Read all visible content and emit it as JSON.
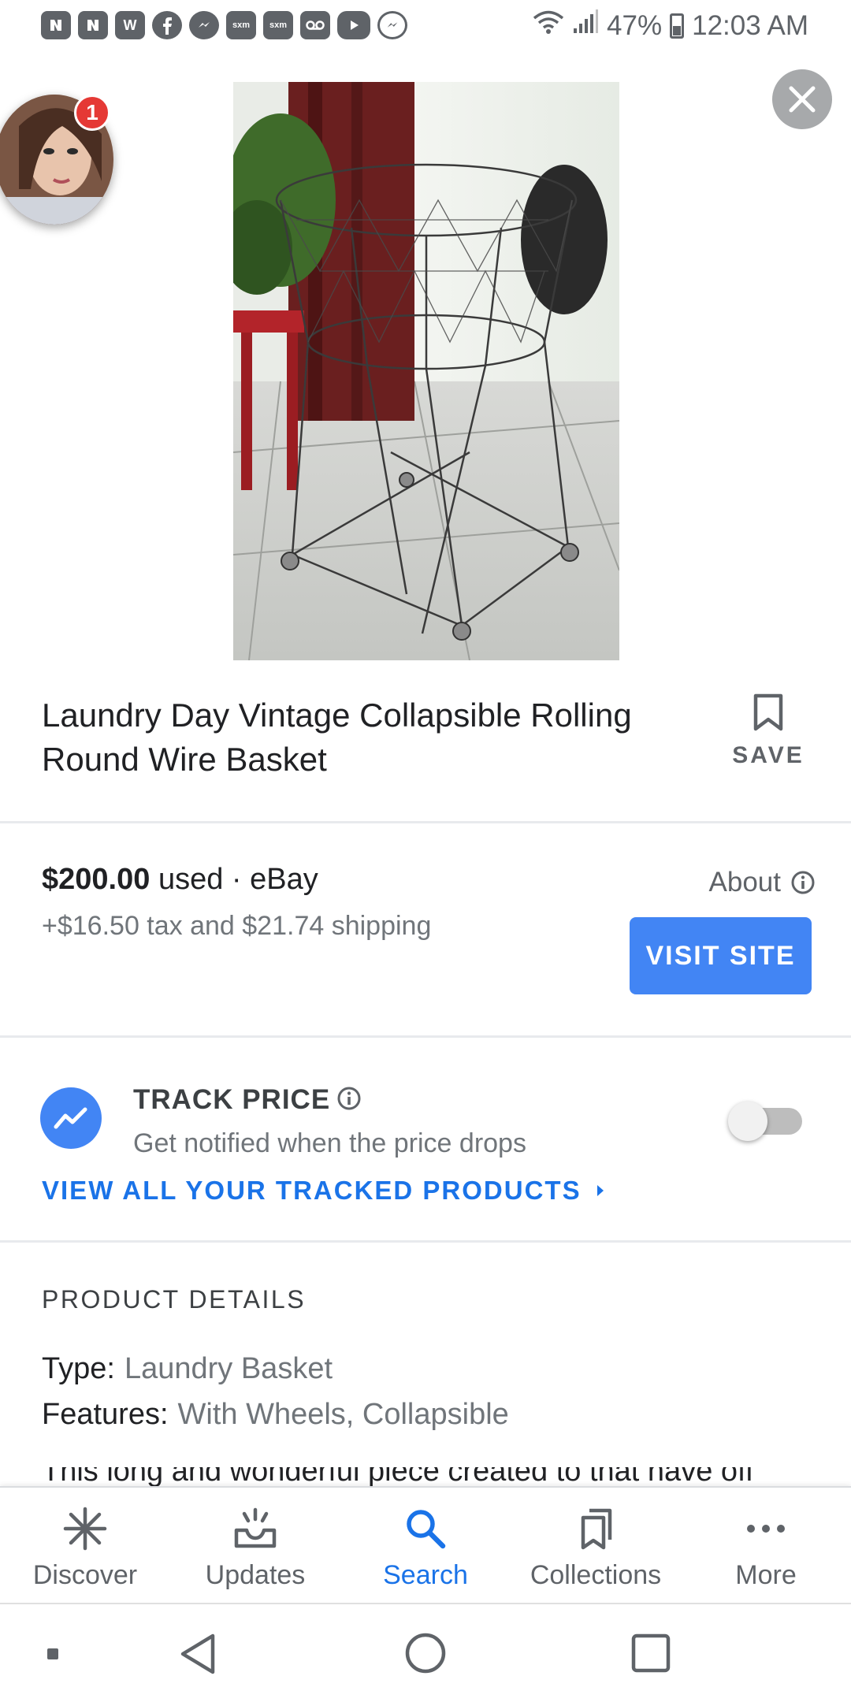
{
  "status_bar": {
    "notification_icons": [
      "nfl-icon",
      "nfl-icon",
      "walmart-icon",
      "facebook-icon",
      "messenger-icon",
      "sxm-icon",
      "sxm-icon",
      "voicemail-icon",
      "youtube-icon",
      "messenger-icon"
    ],
    "sxm_label": "sxm",
    "walmart_label": "W",
    "battery": "47%",
    "time": "12:03 AM"
  },
  "chat_head": {
    "badge": "1"
  },
  "product": {
    "title": "Laundry Day Vintage Collapsible Rolling Round Wire Basket",
    "save_label": "SAVE"
  },
  "offer": {
    "price": "$200.00",
    "condition_seller": "used · eBay",
    "extra_costs": "+$16.50 tax and $21.74 shipping",
    "about_label": "About",
    "visit_label": "VISIT SITE"
  },
  "track_price": {
    "title": "TRACK PRICE",
    "subtitle": "Get notified when the price drops",
    "enabled": false,
    "link_label": "VIEW ALL YOUR TRACKED PRODUCTS"
  },
  "details": {
    "heading": "PRODUCT DETAILS",
    "rows": [
      {
        "key": "Type:",
        "value": "Laundry Basket"
      },
      {
        "key": "Features:",
        "value": "With Wheels, Collapsible"
      }
    ],
    "description_partial": "This long and wonderful piece created to that have off"
  },
  "bottom_nav": {
    "items": [
      {
        "label": "Discover",
        "icon": "asterisk-icon",
        "active": false
      },
      {
        "label": "Updates",
        "icon": "inbox-icon",
        "active": false
      },
      {
        "label": "Search",
        "icon": "search-icon",
        "active": true
      },
      {
        "label": "Collections",
        "icon": "bookmarks-icon",
        "active": false
      },
      {
        "label": "More",
        "icon": "more-dots-icon",
        "active": false
      }
    ]
  },
  "colors": {
    "accent": "#1a73e8",
    "button_blue": "#4285f4",
    "text_primary": "#202124",
    "text_secondary": "#70757a"
  }
}
